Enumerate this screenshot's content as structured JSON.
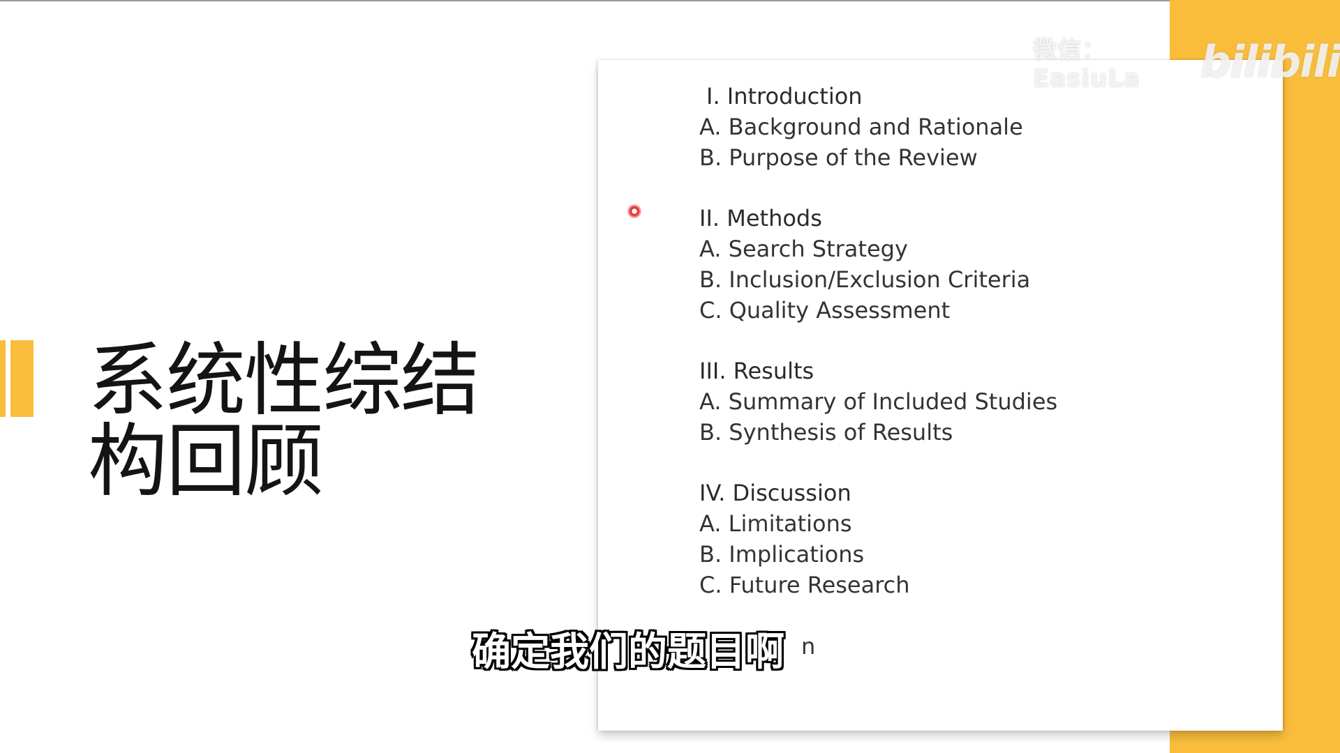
{
  "slide": {
    "title_line1": "系统性综结",
    "title_line2": "构回顾"
  },
  "outline": {
    "sections": [
      {
        "heading": "I. Introduction",
        "items": [
          "A. Background and Rationale",
          "B. Purpose of the Review"
        ]
      },
      {
        "heading": "II. Methods",
        "items": [
          "A. Search Strategy",
          "B. Inclusion/Exclusion Criteria",
          "C. Quality Assessment"
        ]
      },
      {
        "heading": "III. Results",
        "items": [
          "A. Summary of Included Studies",
          "B. Synthesis of Results"
        ]
      },
      {
        "heading": "IV. Discussion",
        "items": [
          "A. Limitations",
          "B. Implications",
          "C. Future Research"
        ]
      }
    ],
    "partial_tail": "n"
  },
  "subtitle": {
    "text": "确定我们的题目啊"
  },
  "watermark": {
    "user": "微信：EasiuLa",
    "logo": "bilibili"
  },
  "colors": {
    "accent": "#f9bd3b",
    "laser": "#e23a3a"
  }
}
